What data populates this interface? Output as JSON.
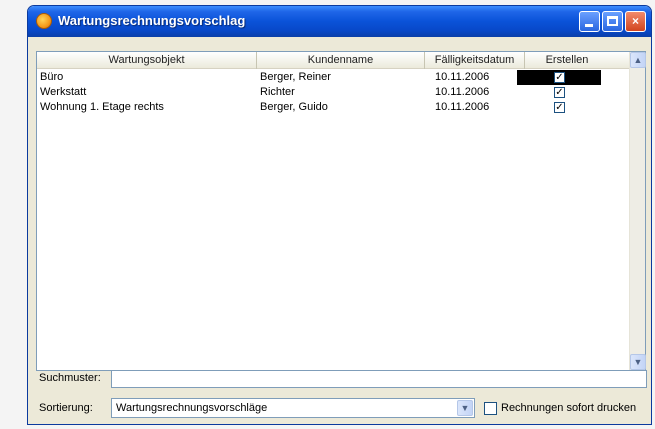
{
  "window": {
    "title": "Wartungsrechnungsvorschlag",
    "min_label": "",
    "max_label": "",
    "close_label": "×"
  },
  "table": {
    "columns": [
      "Wartungsobjekt",
      "Kundenname",
      "Fälligkeitsdatum",
      "Erstellen"
    ],
    "rows": [
      {
        "object": "Büro",
        "customer": "Berger, Reiner",
        "due": "10.11.2006",
        "create": true,
        "selected": true
      },
      {
        "object": "Werkstatt",
        "customer": "Richter",
        "due": "10.11.2006",
        "create": true,
        "selected": false
      },
      {
        "object": "Wohnung 1. Etage rechts",
        "customer": "Berger, Guido",
        "due": "10.11.2006",
        "create": true,
        "selected": false
      }
    ],
    "check_glyph": "✓"
  },
  "scroll": {
    "up_glyph": "▲",
    "down_glyph": "▼"
  },
  "search": {
    "label": "Suchmuster:",
    "value": ""
  },
  "sort": {
    "label": "Sortierung:",
    "value": "Wartungsrechnungsvorschläge",
    "dropdown_glyph": "▼"
  },
  "print": {
    "label": "Rechnungen sofort drucken",
    "checked": false
  }
}
